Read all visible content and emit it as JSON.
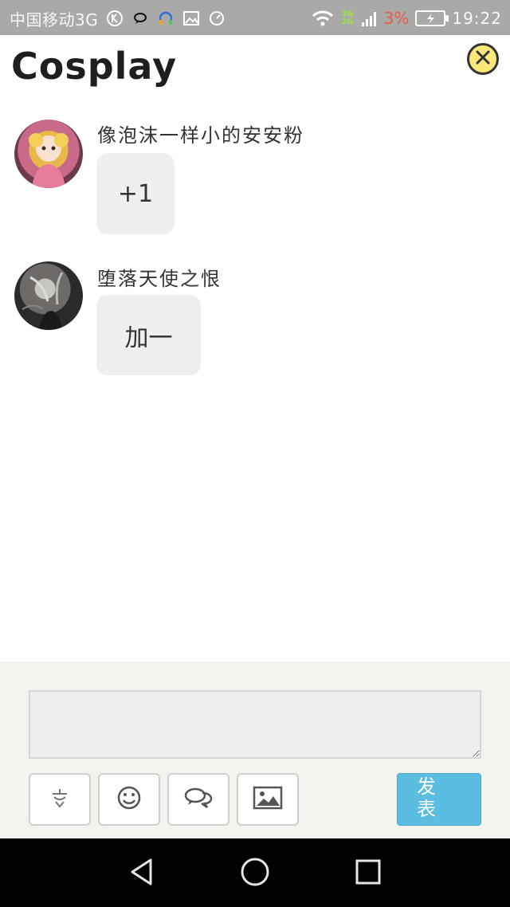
{
  "status_bar": {
    "carrier": "中国移动3G",
    "network_top": "3G",
    "network_bottom": "2G",
    "battery_percent": "3%",
    "time": "19:22",
    "icons": [
      "k-icon",
      "chat-bubble-icon",
      "headset-icon",
      "image-icon",
      "speedometer-icon",
      "wifi-icon",
      "signal-icon",
      "battery-charging-icon"
    ]
  },
  "header": {
    "title": "Cosplay",
    "close_icon": "close-icon"
  },
  "comments": [
    {
      "username": "像泡沫一样小的安安粉",
      "text": "+1",
      "avatar": "pink-anime-avatar"
    },
    {
      "username": "堕落天使之恨",
      "text": "加一",
      "avatar": "dark-anime-avatar"
    }
  ],
  "composer": {
    "input_value": "",
    "tools": [
      "sticker-icon",
      "smiley-icon",
      "chat-icon",
      "picture-icon"
    ],
    "send_label": "发表"
  },
  "navbar": {
    "icons": [
      "back-icon",
      "home-icon",
      "recents-icon"
    ]
  },
  "colors": {
    "status_bar": "#a9a9a7",
    "close_button": "#f8e77a",
    "send_button": "#5bbde0",
    "bubble": "#efefef",
    "composer_bg": "#f3f3ee"
  }
}
